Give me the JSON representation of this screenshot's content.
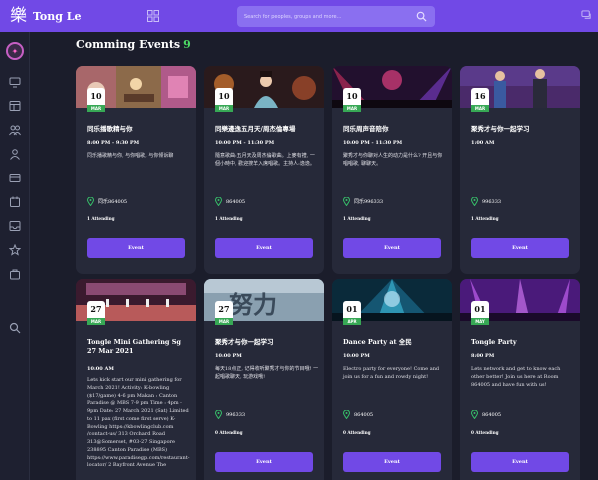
{
  "app": {
    "logo_glyph": "樂",
    "name": "Tong Le"
  },
  "search": {
    "placeholder": "Search for peoples, groups and more..."
  },
  "page": {
    "title": "Comming Events",
    "count": "9"
  },
  "colors": {
    "brand": "#7149e6",
    "background": "#1b1d2b",
    "card": "#262939",
    "accent_green": "#37a855"
  },
  "sidebar": {
    "items": [
      "monitor-icon",
      "calendar-grid-icon",
      "users-group-icon",
      "user-icon",
      "card-icon",
      "date-icon",
      "inbox-icon",
      "star-icon",
      "bag-icon",
      "search-icon"
    ]
  },
  "events": [
    {
      "day": "10",
      "month": "MAR",
      "title": "同乐播歌精与你",
      "time": "8:00 PM - 9:30 PM",
      "desc": "同乐播歌精与你, 与你唱歌, 与你倾诉聊",
      "location": "同乐864005",
      "attending": "1 Attending",
      "button": "Event"
    },
    {
      "day": "10",
      "month": "MAR",
      "title": "同樂邊逸五月天/周杰倫專場",
      "time": "10:00 PM - 11:30 PM",
      "desc": "隨意歌曲:五月天及周杰倫歌曲。上麥有禮, 一個小時中, 歡迎搜羊入席唱歌。主持人:逸逸。",
      "location": "864005",
      "attending": "1 Attending",
      "button": "Event"
    },
    {
      "day": "10",
      "month": "MAR",
      "title": "同乐周声音陪你",
      "time": "10:00 PM - 11:30 PM",
      "desc": "聚秀才与你聊对人生的动力是什么? 开且与你唱唱歌, 聊聊天。",
      "location": "同乐996333",
      "attending": "1 Attending",
      "button": "Event"
    },
    {
      "day": "16",
      "month": "MAR",
      "title": "聚秀才与你一起学习",
      "time": "1:00 AM",
      "desc": "",
      "location": "996333",
      "attending": "1 Attending",
      "button": "Event"
    },
    {
      "day": "27",
      "month": "MAR",
      "title": "Tongle Mini Gathering Sg 27 Mar 2021",
      "time": "10:00 AM",
      "desc": "Lets kick start our mini gathering for March 2021! Activity: K-bowling ($17/game) 4-6 pm Makan : Canton Paradise @ MBS 7-9 pm Time : 4pm - 9pm Date: 27 March 2021 (Sat) Limited to 11 pax (first come first serve) K-Bowling https://kbowlingclub.com /contact-us/ 313 Orchard Road 313@Somerset, #03-27 Singapore 238895 Canton Paradise (MBS) https://www.paradisegp.com/restaurant-locator/ 2 Bayfront Avenue The",
      "location": "",
      "attending": "",
      "button": ""
    },
    {
      "day": "27",
      "month": "MAR",
      "title": "聚秀才与你一起学习",
      "time": "10:00 PM",
      "desc": "每天18点正, 记得收听聚秀才与你的节目哦! 一起唱歌聊天, 玩游戏哦!",
      "location": "996333",
      "attending": "0 Attending",
      "button": "Event"
    },
    {
      "day": "01",
      "month": "APR",
      "title": "Dance Party at 全民",
      "time": "10:00 PM",
      "desc": "Electro party for everyone! Come and join us for a fun and rowdy night!",
      "location": "864005",
      "attending": "0 Attending",
      "button": "Event"
    },
    {
      "day": "01",
      "month": "MAY",
      "title": "Tongle Party",
      "time": "8:00 PM",
      "desc": "Lets network and get to know each other better! Join us here at Room 864005 and have fun with us!",
      "location": "864005",
      "attending": "0 Attending",
      "button": "Event"
    }
  ]
}
